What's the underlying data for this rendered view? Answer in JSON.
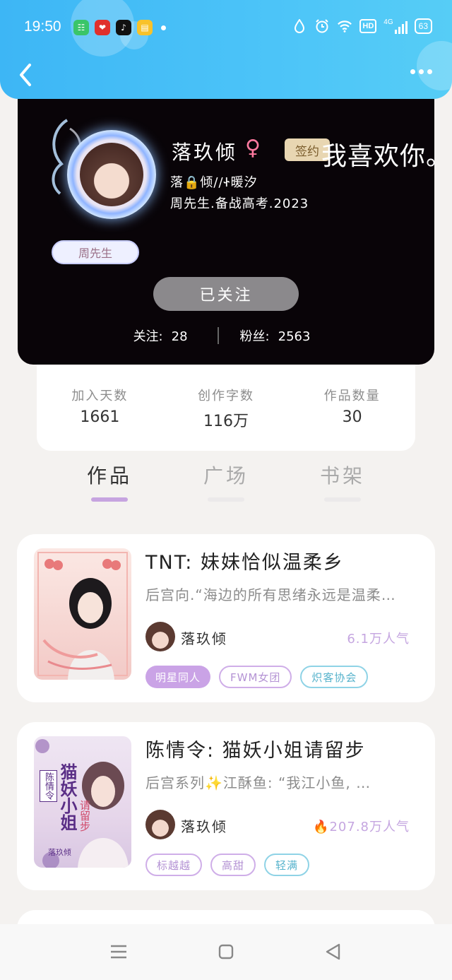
{
  "status_bar": {
    "time": "19:50",
    "notification_apps": [
      "wechat-icon",
      "pinduoduo-icon",
      "tiktok-icon",
      "reader-icon"
    ],
    "hd_label": "HD",
    "network_label": "4G",
    "battery": "63"
  },
  "profile": {
    "avatar_tag": "周先生",
    "username": "落玖倾",
    "gender_icon": "♀",
    "signed_badge": "签约",
    "motto": "我喜欢你。",
    "bio_line1": "落🔒倾//Ꮠ暖汐",
    "bio_line2": "周先生.备战高考.2023",
    "follow_button": "已关注",
    "following_label": "关注:",
    "following_count": "28",
    "fans_label": "粉丝:",
    "fans_count": "2563"
  },
  "stats": [
    {
      "label": "加入天数",
      "value": "1661"
    },
    {
      "label": "创作字数",
      "value": "116万"
    },
    {
      "label": "作品数量",
      "value": "30"
    }
  ],
  "tabs": [
    {
      "label": "作品",
      "active": true
    },
    {
      "label": "广场",
      "active": false
    },
    {
      "label": "书架",
      "active": false
    }
  ],
  "works": [
    {
      "title": "TNT: 妹妹恰似温柔乡",
      "desc": "后宫向.“海边的所有思绪永远是温柔…",
      "author": "落玖倾",
      "popularity": "6.1万人气",
      "tags": [
        "明星同人",
        "FWM女团",
        "炽客协会"
      ]
    },
    {
      "title": "陈情令: 猫妖小姐请留步",
      "desc": "后宫系列✨江酥鱼: “我江小鱼, …",
      "author": "落玖倾",
      "popularity": "207.8万人气",
      "tags": [
        "标越越",
        "高甜",
        "轻满"
      ],
      "cover_text": [
        "陈情令",
        "猫妖小姐",
        "请留步",
        "落玖倾"
      ]
    }
  ],
  "colors": {
    "header_blue": "#3db6f5",
    "accent_purple": "#caa3e6",
    "card_dark": "#090408"
  }
}
